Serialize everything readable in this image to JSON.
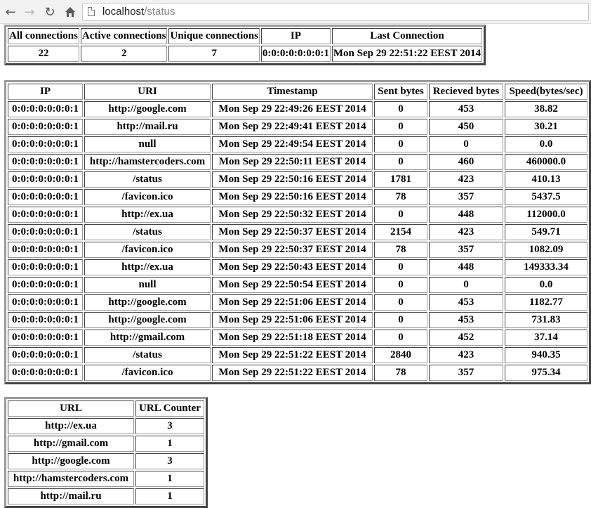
{
  "browser": {
    "url_host": "localhost",
    "url_path": "/status",
    "back_icon": "back-arrow-icon",
    "forward_icon": "forward-arrow-icon",
    "reload_icon": "reload-icon",
    "home_icon": "home-icon"
  },
  "summary": {
    "headers": [
      "All connections",
      "Active connections",
      "Unique connections",
      "IP",
      "Last Connection"
    ],
    "row": [
      "22",
      "2",
      "7",
      "0:0:0:0:0:0:0:1",
      "Mon Sep 29 22:51:22 EEST 2014"
    ]
  },
  "requests": {
    "headers": [
      "IP",
      "URI",
      "Timestamp",
      "Sent bytes",
      "Recieved bytes",
      "Speed(bytes/sec)"
    ],
    "rows": [
      [
        "0:0:0:0:0:0:0:1",
        "http://google.com",
        "Mon Sep 29 22:49:26 EEST 2014",
        "0",
        "453",
        "38.82"
      ],
      [
        "0:0:0:0:0:0:0:1",
        "http://mail.ru",
        "Mon Sep 29 22:49:41 EEST 2014",
        "0",
        "450",
        "30.21"
      ],
      [
        "0:0:0:0:0:0:0:1",
        "null",
        "Mon Sep 29 22:49:54 EEST 2014",
        "0",
        "0",
        "0.0"
      ],
      [
        "0:0:0:0:0:0:0:1",
        "http://hamstercoders.com",
        "Mon Sep 29 22:50:11 EEST 2014",
        "0",
        "460",
        "460000.0"
      ],
      [
        "0:0:0:0:0:0:0:1",
        "/status",
        "Mon Sep 29 22:50:16 EEST 2014",
        "1781",
        "423",
        "410.13"
      ],
      [
        "0:0:0:0:0:0:0:1",
        "/favicon.ico",
        "Mon Sep 29 22:50:16 EEST 2014",
        "78",
        "357",
        "5437.5"
      ],
      [
        "0:0:0:0:0:0:0:1",
        "http://ex.ua",
        "Mon Sep 29 22:50:32 EEST 2014",
        "0",
        "448",
        "112000.0"
      ],
      [
        "0:0:0:0:0:0:0:1",
        "/status",
        "Mon Sep 29 22:50:37 EEST 2014",
        "2154",
        "423",
        "549.71"
      ],
      [
        "0:0:0:0:0:0:0:1",
        "/favicon.ico",
        "Mon Sep 29 22:50:37 EEST 2014",
        "78",
        "357",
        "1082.09"
      ],
      [
        "0:0:0:0:0:0:0:1",
        "http://ex.ua",
        "Mon Sep 29 22:50:43 EEST 2014",
        "0",
        "448",
        "149333.34"
      ],
      [
        "0:0:0:0:0:0:0:1",
        "null",
        "Mon Sep 29 22:50:54 EEST 2014",
        "0",
        "0",
        "0.0"
      ],
      [
        "0:0:0:0:0:0:0:1",
        "http://google.com",
        "Mon Sep 29 22:51:06 EEST 2014",
        "0",
        "453",
        "1182.77"
      ],
      [
        "0:0:0:0:0:0:0:1",
        "http://google.com",
        "Mon Sep 29 22:51:06 EEST 2014",
        "0",
        "453",
        "731.83"
      ],
      [
        "0:0:0:0:0:0:0:1",
        "http://gmail.com",
        "Mon Sep 29 22:51:18 EEST 2014",
        "0",
        "452",
        "37.14"
      ],
      [
        "0:0:0:0:0:0:0:1",
        "/status",
        "Mon Sep 29 22:51:22 EEST 2014",
        "2840",
        "423",
        "940.35"
      ],
      [
        "0:0:0:0:0:0:0:1",
        "/favicon.ico",
        "Mon Sep 29 22:51:22 EEST 2014",
        "78",
        "357",
        "975.34"
      ]
    ]
  },
  "url_counter": {
    "headers": [
      "URL",
      "URL Counter"
    ],
    "rows": [
      [
        "http://ex.ua",
        "3"
      ],
      [
        "http://gmail.com",
        "1"
      ],
      [
        "http://google.com",
        "3"
      ],
      [
        "http://hamstercoders.com",
        "1"
      ],
      [
        "http://mail.ru",
        "1"
      ]
    ]
  }
}
